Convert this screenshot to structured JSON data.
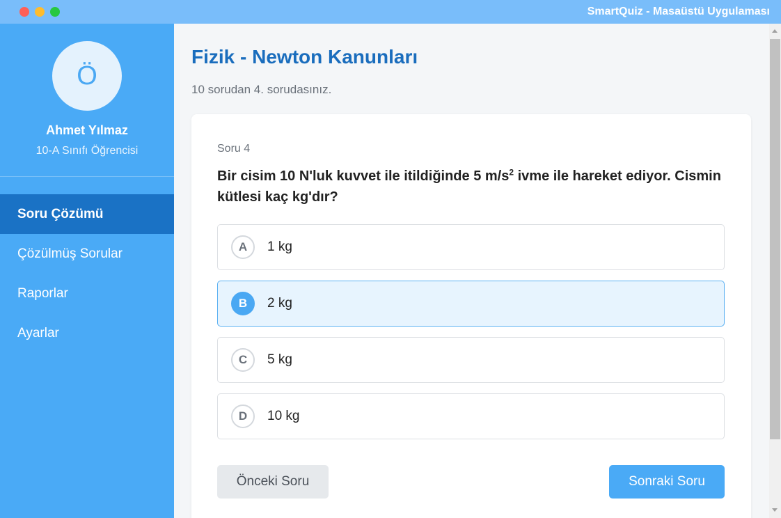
{
  "window": {
    "title": "SmartQuiz - Masaüstü Uygulaması"
  },
  "user": {
    "avatar_initial": "Ö",
    "name": "Ahmet Yılmaz",
    "role": "10-A Sınıfı Öğrencisi"
  },
  "nav": {
    "items": [
      {
        "label": "Soru Çözümü",
        "active": true
      },
      {
        "label": "Çözülmüş Sorular",
        "active": false
      },
      {
        "label": "Raporlar",
        "active": false
      },
      {
        "label": "Ayarlar",
        "active": false
      }
    ]
  },
  "quiz": {
    "title": "Fizik - Newton Kanunları",
    "progress": "10 sorudan 4. sorudasınız.",
    "question_number": "Soru 4",
    "question_pre": "Bir cisim 10 N'luk kuvvet ile itildiğinde 5 m/s",
    "question_sup": "2",
    "question_post": " ivme ile hareket ediyor. Cismin kütlesi kaç kg'dır?",
    "options": [
      {
        "letter": "A",
        "label": "1 kg",
        "selected": false
      },
      {
        "letter": "B",
        "label": "2 kg",
        "selected": true
      },
      {
        "letter": "C",
        "label": "5 kg",
        "selected": false
      },
      {
        "letter": "D",
        "label": "10 kg",
        "selected": false
      }
    ],
    "prev_label": "Önceki Soru",
    "next_label": "Sonraki Soru"
  },
  "colors": {
    "sidebar": "#4aaaf6",
    "sidebar_active": "#1a72c5",
    "title": "#1a6dbd",
    "selected_option_bg": "#e7f4fe"
  }
}
